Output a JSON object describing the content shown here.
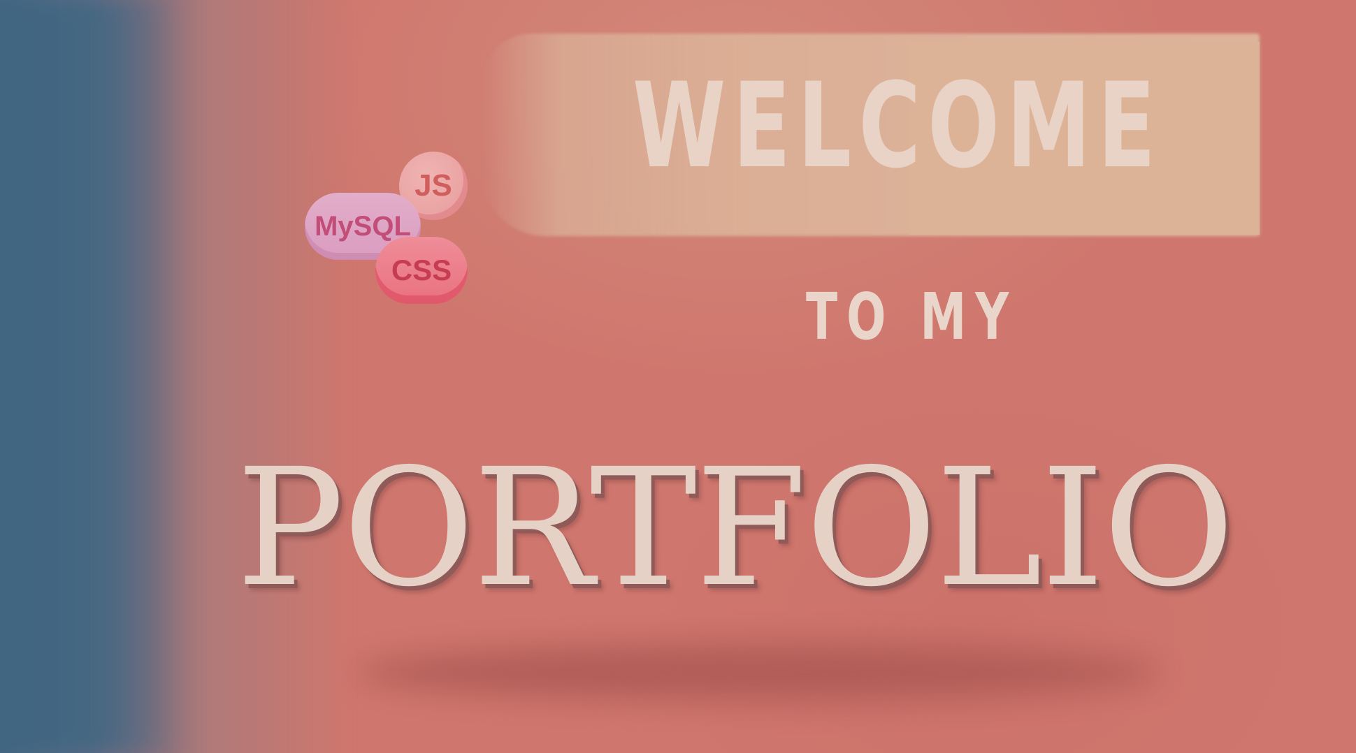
{
  "banner": {
    "headline_1": "WELCOME",
    "headline_2": "TO MY",
    "headline_3": "PORTFOLIO"
  },
  "skills": [
    {
      "label": "JS"
    },
    {
      "label": "MySQL"
    },
    {
      "label": "CSS"
    }
  ],
  "colors": {
    "background": "#cf776e",
    "left_band": "#3f6681",
    "welcome_swatch": "#dcb29a",
    "headline_text": "#e9d2c6",
    "portfolio_shadow": "#8f5a58"
  }
}
